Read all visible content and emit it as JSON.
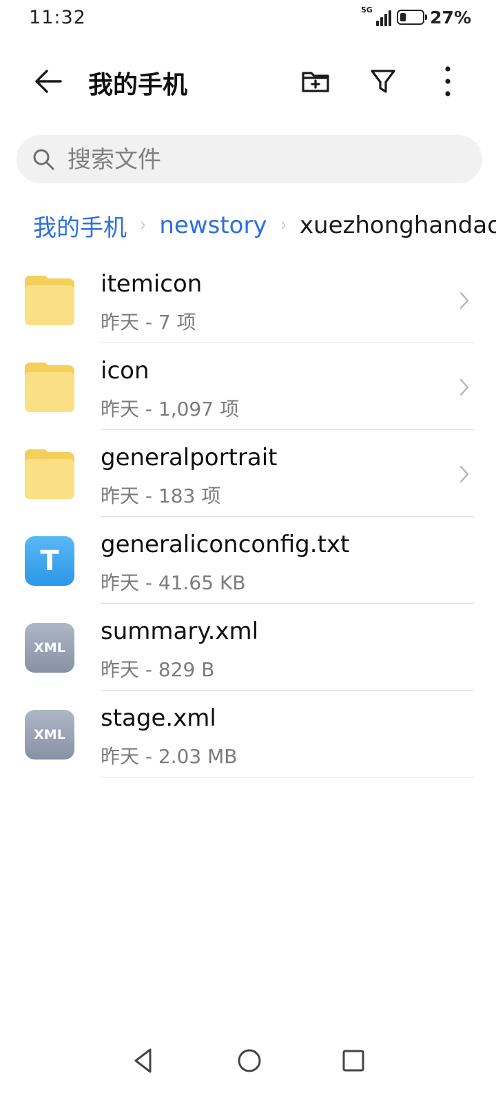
{
  "status_bar": {
    "time": "11:32",
    "network": "5G",
    "battery_percent": "27%",
    "battery_level": 0.27
  },
  "app_bar": {
    "title": "我的手机",
    "icons": [
      "arrow-left-icon",
      "folder-plus-icon",
      "filter-icon",
      "more-vert-icon"
    ]
  },
  "search": {
    "placeholder": "搜索文件"
  },
  "breadcrumb": [
    {
      "label": "我的手机"
    },
    {
      "label": "newstory"
    },
    {
      "label": "xuezhonghandao"
    }
  ],
  "files": [
    {
      "name": "itemicon",
      "meta": "昨天 - 7 项",
      "type": "folder",
      "icon": "folder-icon"
    },
    {
      "name": "icon",
      "meta": "昨天 - 1,097 项",
      "type": "folder",
      "icon": "folder-icon"
    },
    {
      "name": "generalportrait",
      "meta": "昨天 - 183 项",
      "type": "folder",
      "icon": "folder-icon"
    },
    {
      "name": "generaliconconfig.txt",
      "meta": "昨天 - 41.65 KB",
      "type": "txt",
      "icon": "text-file-icon",
      "badge": "T"
    },
    {
      "name": "summary.xml",
      "meta": "昨天 - 829 B",
      "type": "xml",
      "icon": "xml-file-icon",
      "badge": "XML"
    },
    {
      "name": "stage.xml",
      "meta": "昨天 - 2.03 MB",
      "type": "xml",
      "icon": "xml-file-icon",
      "badge": "XML"
    }
  ],
  "nav_bar": {
    "icons": [
      "nav-back-icon",
      "nav-home-icon",
      "nav-recents-icon"
    ]
  },
  "colors": {
    "accent": "#2d6fe0",
    "folder": "#fadf85",
    "txt_icon": "#2c96e8",
    "xml_icon": "#8791a5"
  }
}
